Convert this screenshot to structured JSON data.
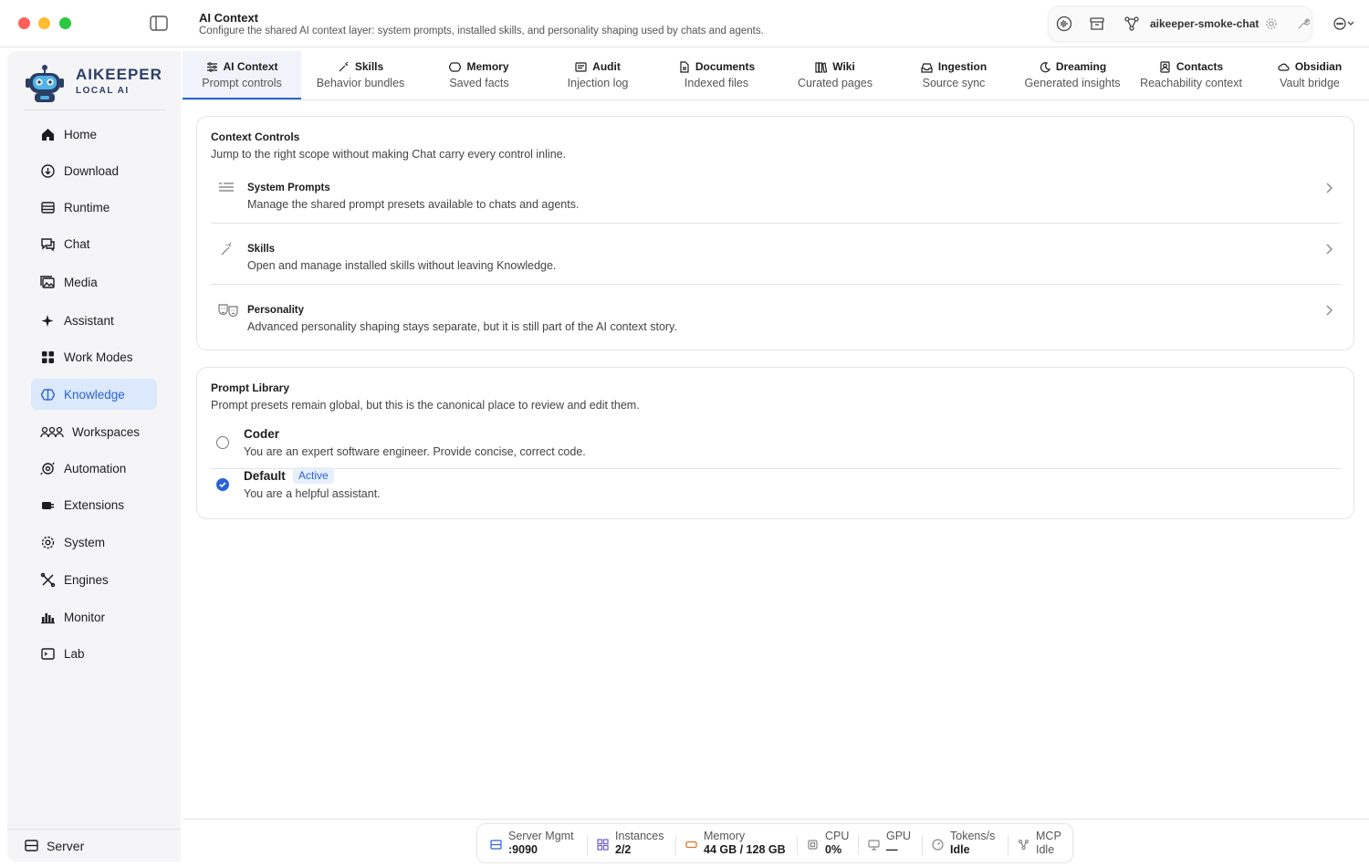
{
  "window": {
    "title": "AI Context",
    "subtitle": "Configure the shared AI context layer: system prompts, installed skills, and personality shaping used by chats and agents.",
    "server_name": "aikeeper-smoke-chat"
  },
  "brand": {
    "name": "AIKEEPER",
    "tagline": "LOCAL AI",
    "accent": "#2a3e66"
  },
  "sidebar": {
    "items": [
      {
        "label": "Home",
        "icon": "home-icon"
      },
      {
        "label": "Download",
        "icon": "download-icon"
      },
      {
        "label": "Runtime",
        "icon": "runtime-icon"
      },
      {
        "label": "Chat",
        "icon": "chat-icon"
      },
      {
        "label": "Media",
        "icon": "media-icon"
      },
      {
        "label": "Assistant",
        "icon": "sparkle-icon"
      },
      {
        "label": "Work Modes",
        "icon": "grid-icon"
      },
      {
        "label": "Knowledge",
        "icon": "brain-icon",
        "active": true
      },
      {
        "label": "Workspaces",
        "icon": "people-icon"
      },
      {
        "label": "Automation",
        "icon": "automation-icon"
      },
      {
        "label": "Extensions",
        "icon": "plug-icon"
      },
      {
        "label": "System",
        "icon": "gear-icon"
      },
      {
        "label": "Engines",
        "icon": "tools-icon"
      },
      {
        "label": "Monitor",
        "icon": "chart-icon"
      },
      {
        "label": "Lab",
        "icon": "terminal-icon"
      }
    ],
    "footer": "Server"
  },
  "tabs": [
    {
      "label": "AI Context",
      "sub": "Prompt controls",
      "active": true
    },
    {
      "label": "Skills",
      "sub": "Behavior bundles"
    },
    {
      "label": "Memory",
      "sub": "Saved facts"
    },
    {
      "label": "Audit",
      "sub": "Injection log"
    },
    {
      "label": "Documents",
      "sub": "Indexed files"
    },
    {
      "label": "Wiki",
      "sub": "Curated pages"
    },
    {
      "label": "Ingestion",
      "sub": "Source sync"
    },
    {
      "label": "Dreaming",
      "sub": "Generated insights"
    },
    {
      "label": "Contacts",
      "sub": "Reachability context"
    },
    {
      "label": "Obsidian",
      "sub": "Vault bridge"
    }
  ],
  "context_controls": {
    "title": "Context Controls",
    "description": "Jump to the right scope without making Chat carry every control inline.",
    "rows": [
      {
        "title": "System Prompts",
        "description": "Manage the shared prompt presets available to chats and agents."
      },
      {
        "title": "Skills",
        "description": "Open and manage installed skills without leaving Knowledge."
      },
      {
        "title": "Personality",
        "description": "Advanced personality shaping stays separate, but it is still part of the AI context story."
      }
    ]
  },
  "prompt_library": {
    "title": "Prompt Library",
    "description": "Prompt presets remain global, but this is the canonical place to review and edit them.",
    "presets": [
      {
        "name": "Coder",
        "description": "You are an expert software engineer. Provide concise, correct code.",
        "selected": false
      },
      {
        "name": "Default",
        "description": "You are a helpful assistant.",
        "selected": true,
        "badge": "Active"
      }
    ]
  },
  "status": [
    {
      "label": "Server Mgmt",
      "value": ":9090"
    },
    {
      "label": "Instances",
      "value": "2/2"
    },
    {
      "label": "Memory",
      "value": "44 GB / 128 GB"
    },
    {
      "label": "CPU",
      "value": "0%"
    },
    {
      "label": "GPU",
      "value": "—"
    },
    {
      "label": "Tokens/s",
      "value": "Idle"
    },
    {
      "label": "MCP",
      "value": "Idle"
    }
  ],
  "colors": {
    "accent": "#2a64d6",
    "active_bg": "#dce8fb"
  }
}
